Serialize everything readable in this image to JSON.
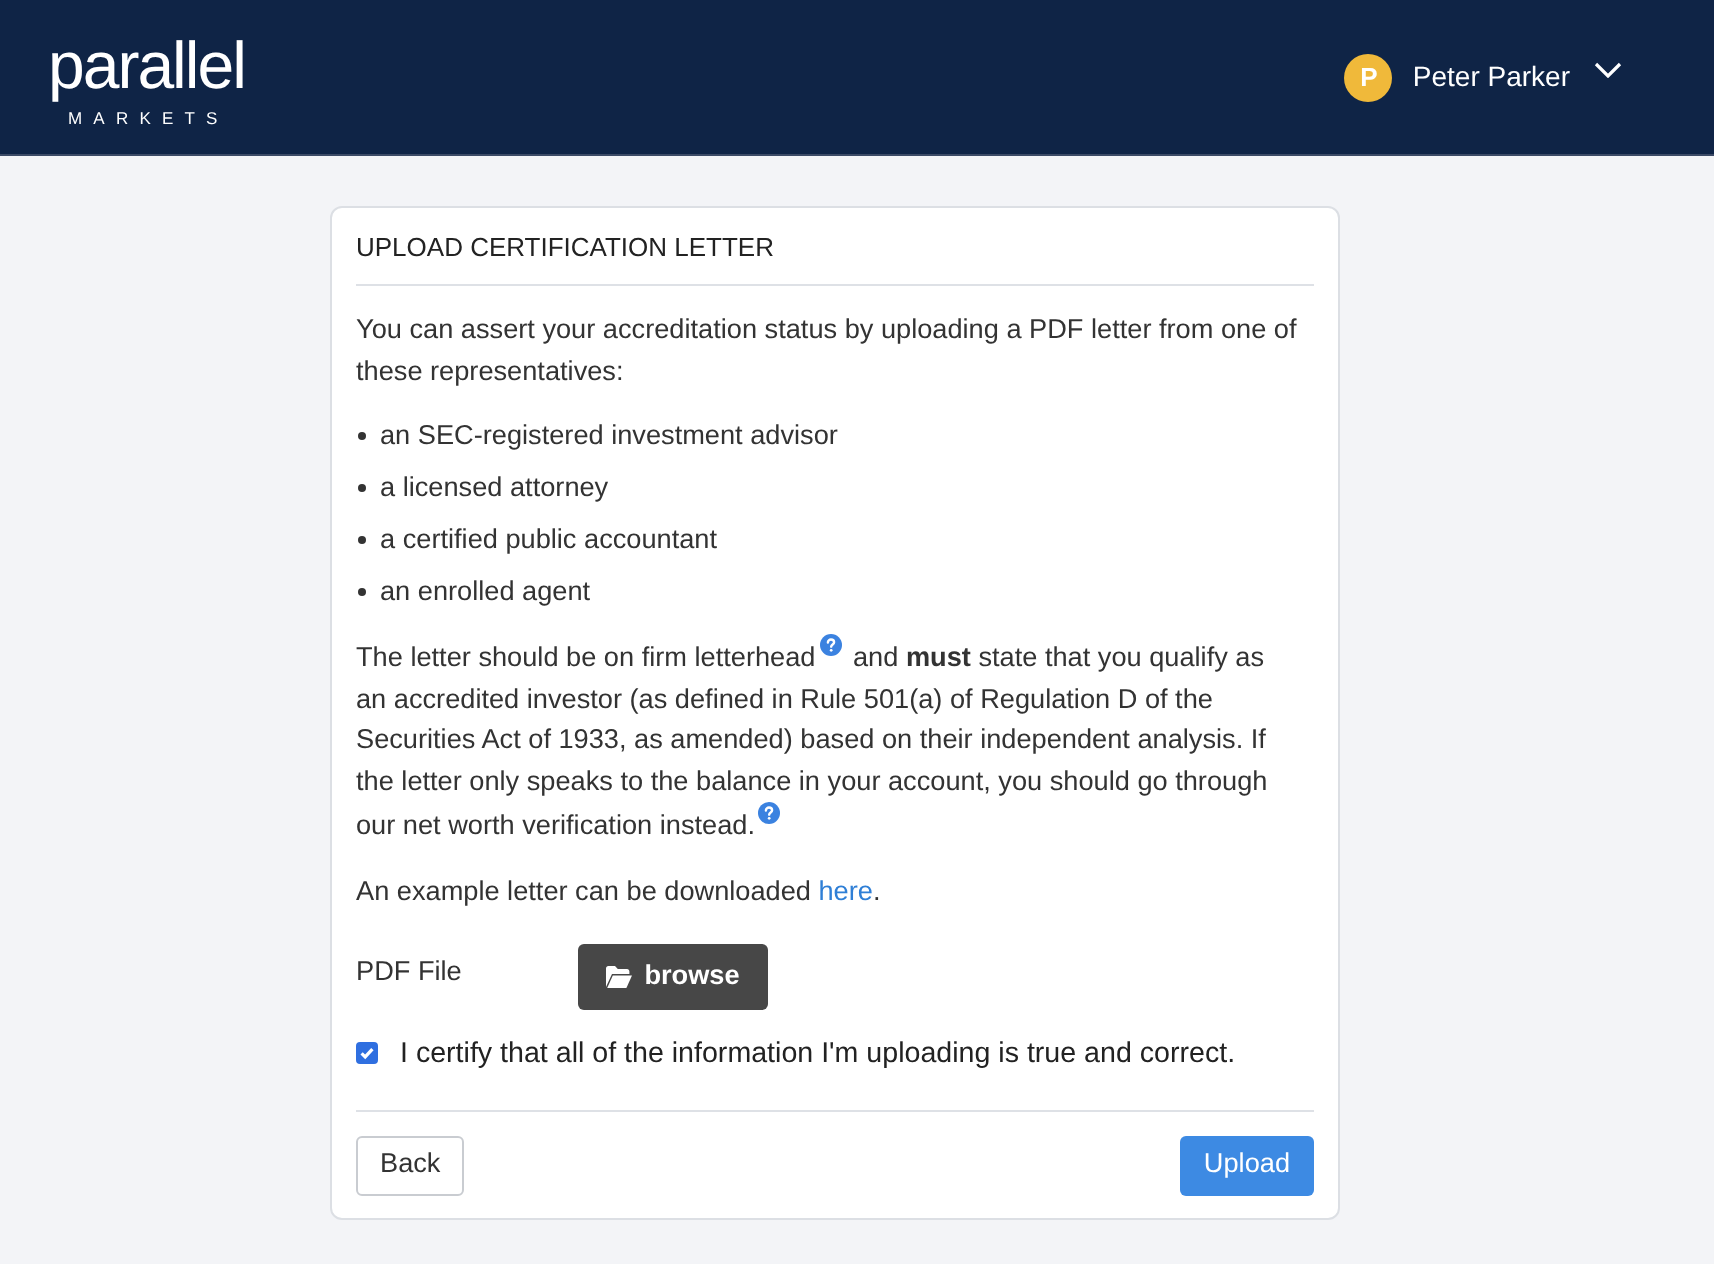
{
  "header": {
    "logo": {
      "word": "parallel",
      "subword": "MARKETS"
    },
    "user": {
      "initial": "P",
      "name": "Peter Parker"
    }
  },
  "card": {
    "title": "UPLOAD CERTIFICATION LETTER",
    "intro": "You can assert your accreditation status by uploading a PDF letter from one of these representatives:",
    "representatives": [
      "an SEC-registered investment advisor",
      "a licensed attorney",
      "a certified public accountant",
      "an enrolled agent"
    ],
    "notice": [
      {
        "text": "The letter should be on firm letterhead",
        "help_icon": true
      },
      {
        "text": " and **must** state that you qualify as an accredited investor (as defined in Rule 501(a) of Regulation D of the Securities Act of 1933, as amended) based on their independent analysis. If the letter only speaks to the balance in your account, you should go through our net worth verification instead.",
        "help_icon": true
      }
    ],
    "example": {
      "before": "An example letter can be downloaded ",
      "link": "here",
      "after": "."
    },
    "file_field": {
      "label": "PDF File",
      "button": "browse"
    },
    "certify": {
      "label": "I certify that all of the information I'm uploading is true and correct.",
      "checked": true
    },
    "buttons": [
      {
        "label": "Back",
        "kind": "secondary"
      },
      {
        "label": "Upload",
        "kind": "primary"
      }
    ]
  }
}
